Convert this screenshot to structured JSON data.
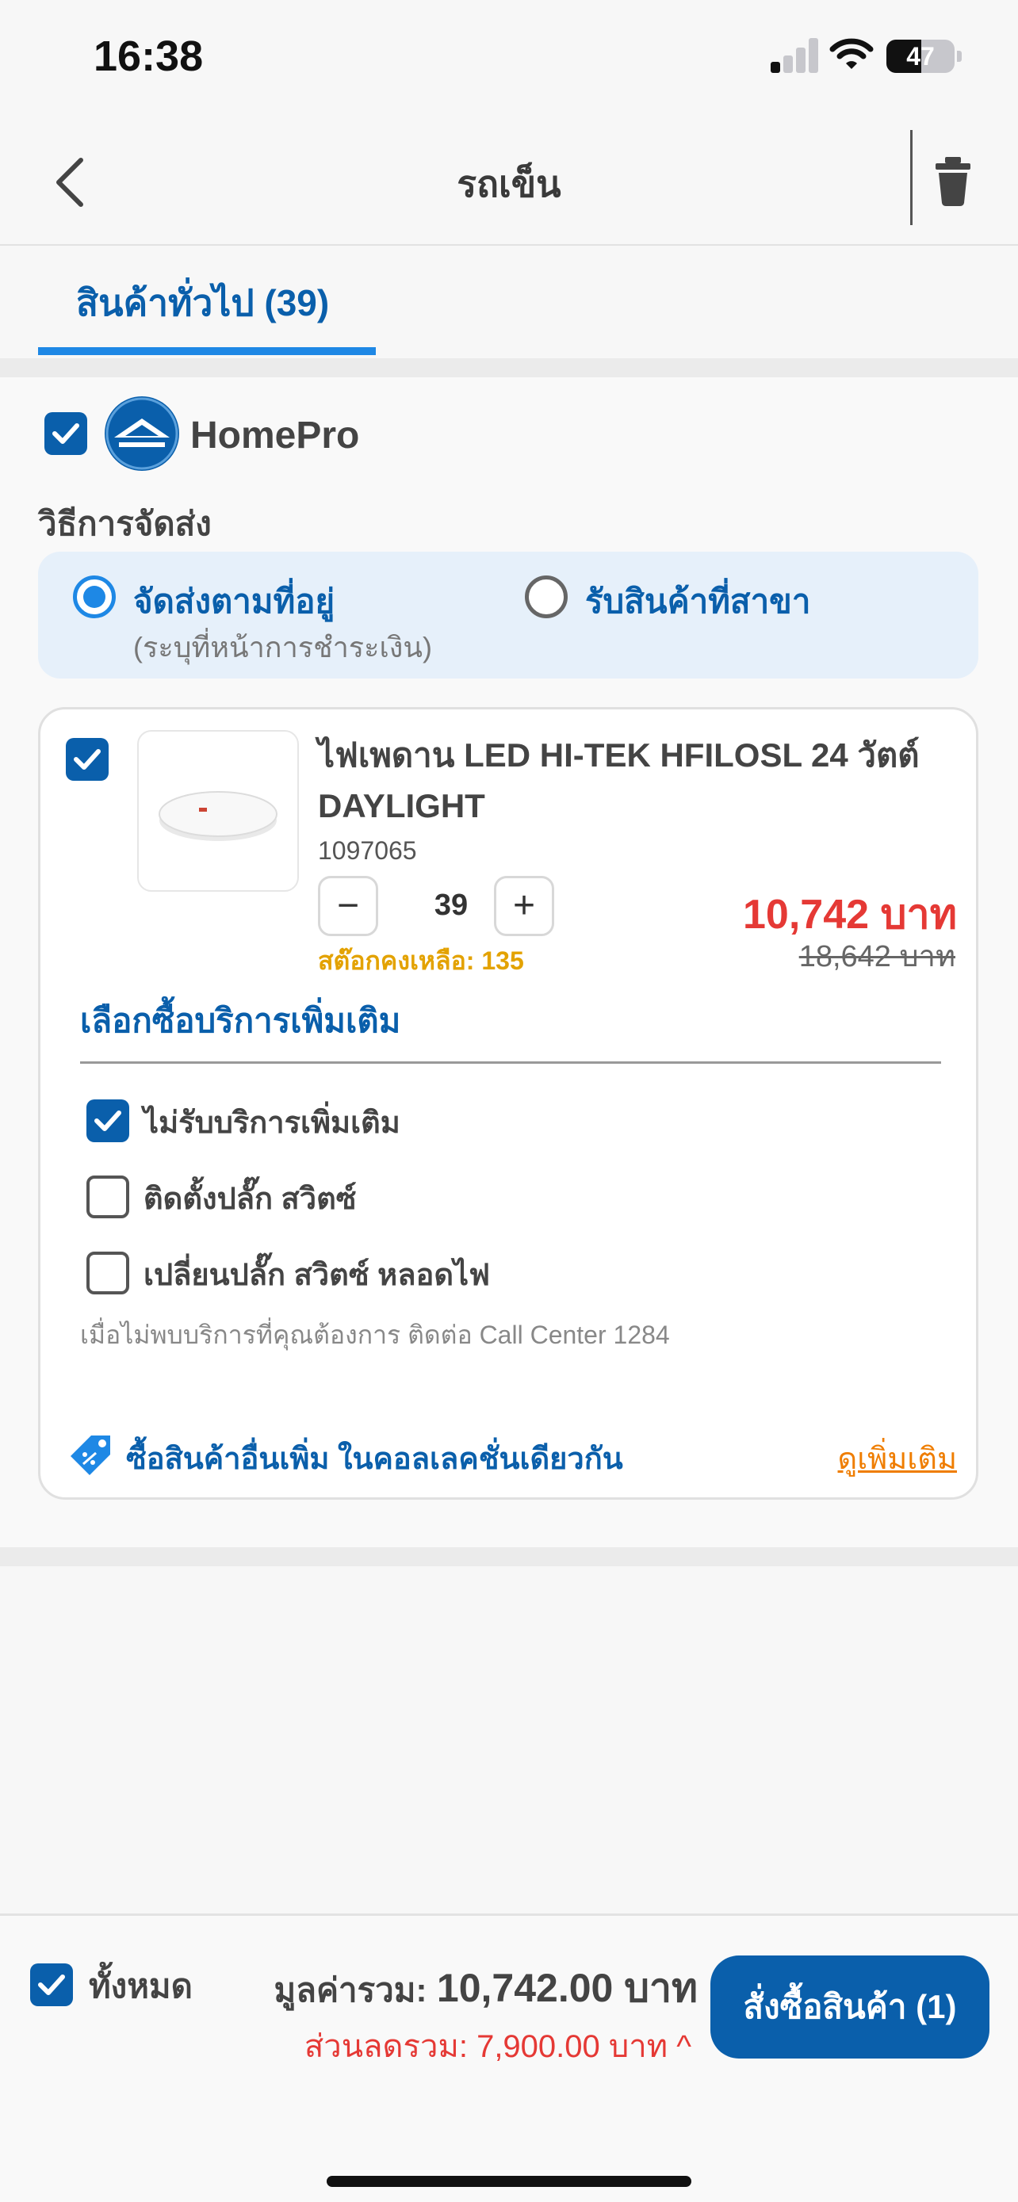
{
  "status": {
    "time": "16:38",
    "battery": "47"
  },
  "nav": {
    "title": "รถเข็น"
  },
  "tabs": [
    {
      "label": "สินค้าทั่วไป (39)",
      "active": true
    }
  ],
  "store": {
    "name": "HomePro",
    "shipping_title": "วิธีการจัดส่ง",
    "options": [
      {
        "label": "จัดส่งตามที่อยู่",
        "sub": "(ระบุที่หน้าการชำระเงิน)",
        "selected": true
      },
      {
        "label": "รับสินค้าที่สาขา",
        "selected": false
      }
    ]
  },
  "product": {
    "name": "ไฟเพดาน LED HI-TEK HFILOSL 24 วัตต์ DAYLIGHT",
    "sku": "1097065",
    "qty": "39",
    "minus": "−",
    "plus": "+",
    "stock": "สต๊อกคงเหลือ: 135",
    "price": "10,742 บาท",
    "old_price": "18,642 บาท"
  },
  "services": {
    "title": "เลือกซื้อบริการเพิ่มเติม",
    "items": [
      {
        "label": "ไม่รับบริการเพิ่มเติม",
        "checked": true
      },
      {
        "label": "ติดตั้งปลั๊ก สวิตซ์",
        "checked": false
      },
      {
        "label": "เปลี่ยนปลั๊ก สวิตซ์ หลอดไฟ",
        "checked": false
      }
    ],
    "note": "เมื่อไม่พบบริการที่คุณต้องการ ติดต่อ Call Center 1284"
  },
  "more": {
    "label": "ซื้อสินค้าอื่นเพิ่ม ในคอลเลคชั่นเดียวกัน",
    "link": "ดูเพิ่มเติม"
  },
  "footer": {
    "all_label": "ทั้งหมด",
    "total_label": "มูลค่ารวม:",
    "total_value": "10,742.00 บาท",
    "discount": "ส่วนลดรวม: 7,900.00 บาท ^",
    "order_button": "สั่งซื้อสินค้า (1)"
  },
  "colors": {
    "primary": "#0a5fab",
    "accent_blue": "#1e88e5",
    "price_red": "#e53935",
    "stock_yellow": "#e3a200",
    "link_orange": "#ef7d00"
  }
}
